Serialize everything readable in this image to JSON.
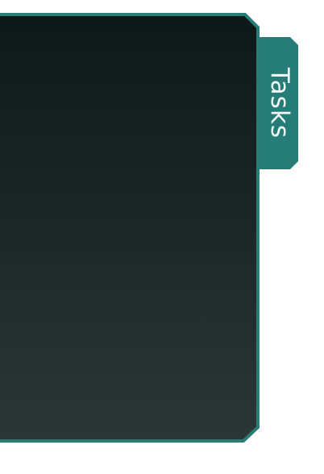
{
  "panel": {
    "background_top": "#0e1817",
    "background_bottom": "#2c3635",
    "border_color": "#2a7d76"
  },
  "tasks_tab": {
    "label": "Tasks",
    "color": "#267d78"
  }
}
